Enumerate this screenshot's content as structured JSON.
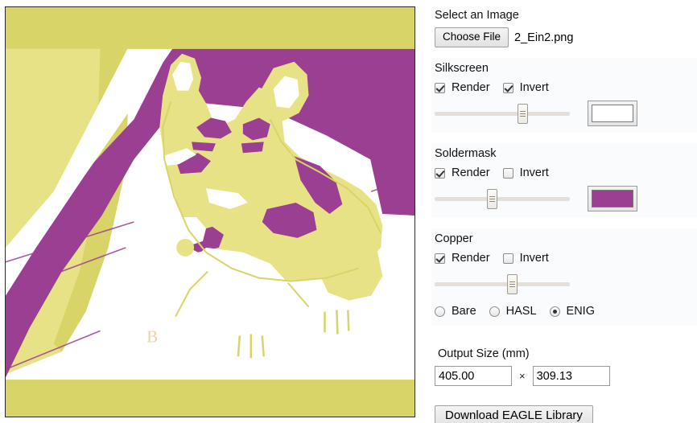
{
  "image_picker": {
    "label": "Select an Image",
    "choose_button": "Choose File",
    "file_name": "2_Ein2.png"
  },
  "layers": [
    {
      "key": "silkscreen",
      "title": "Silkscreen",
      "render_label": "Render",
      "render_checked": true,
      "invert_label": "Invert",
      "invert_checked": true,
      "threshold_percent": 65,
      "color": "#ffffff"
    },
    {
      "key": "soldermask",
      "title": "Soldermask",
      "render_label": "Render",
      "render_checked": true,
      "invert_label": "Invert",
      "invert_checked": false,
      "threshold_percent": 42,
      "color": "#9b3f93"
    },
    {
      "key": "copper",
      "title": "Copper",
      "render_label": "Render",
      "render_checked": true,
      "invert_label": "Invert",
      "invert_checked": false,
      "threshold_percent": 57,
      "finishes": [
        {
          "label": "Bare",
          "selected": false
        },
        {
          "label": "HASL",
          "selected": false
        },
        {
          "label": "ENIG",
          "selected": true
        }
      ]
    }
  ],
  "output_size": {
    "label": "Output Size (mm)",
    "width_value": "405.00",
    "separator": "×",
    "height_value": "309.13"
  },
  "download": {
    "button_label": "Download EAGLE Library"
  },
  "preview": {
    "alt": "Posterized three-tone corgi illustration render",
    "palette": {
      "border_fill": "#d8d468",
      "light_yellow": "#e8e287",
      "purple": "#9b3f93",
      "white": "#ffffff",
      "outline": "#d8d468"
    }
  }
}
